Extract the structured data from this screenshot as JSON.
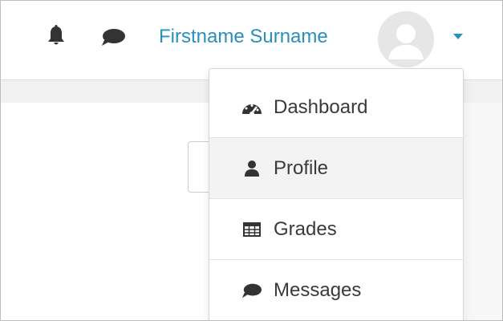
{
  "navbar": {
    "icons": [
      "bell-icon",
      "chat-icon"
    ],
    "user_name": "Firstname Surname",
    "avatar_icon": "avatar-icon",
    "caret_icon": "chevron-down-icon"
  },
  "colors": {
    "accent": "#2a8fbd",
    "icon": "#333333",
    "menu_text": "#3a3a3a",
    "hover_bg": "#f3f3f3"
  },
  "user_menu": {
    "items": [
      {
        "label": "Dashboard",
        "icon": "dashboard-icon"
      },
      {
        "label": "Profile",
        "icon": "user-icon",
        "highlighted": true
      },
      {
        "label": "Grades",
        "icon": "table-icon"
      },
      {
        "label": "Messages",
        "icon": "chat-icon"
      }
    ]
  }
}
